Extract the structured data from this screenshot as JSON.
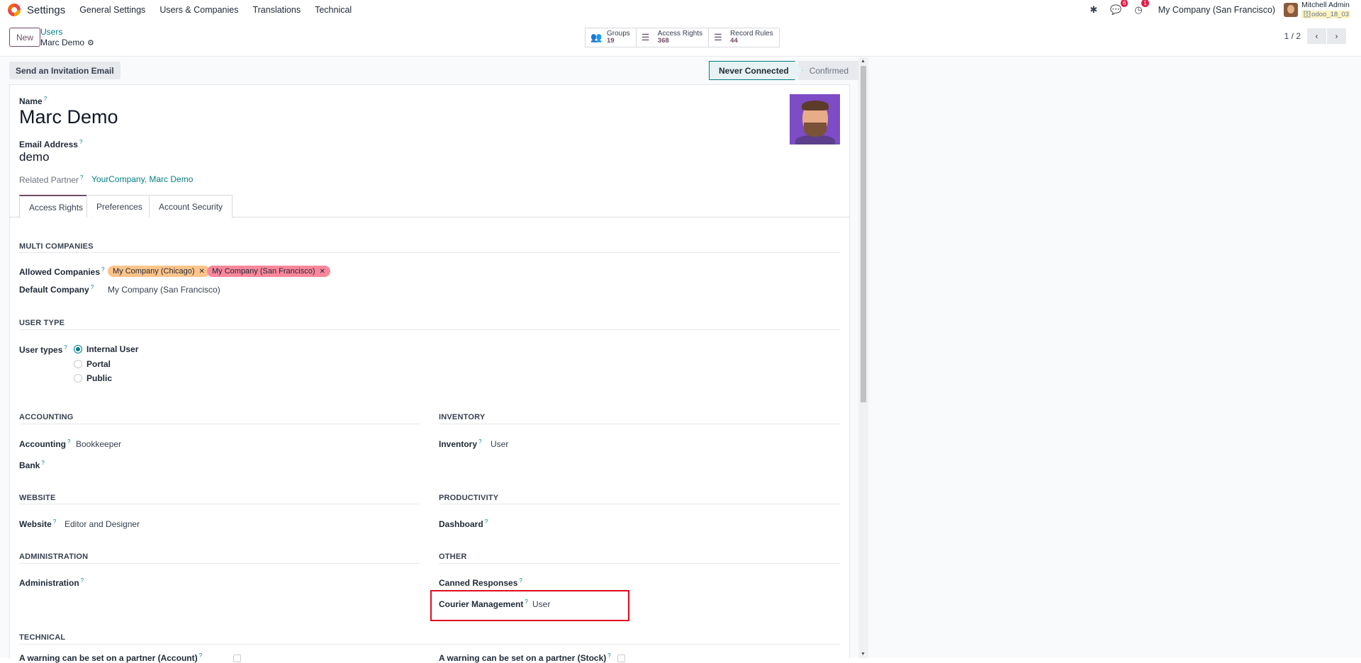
{
  "navbar": {
    "app_name": "Settings",
    "menu": [
      "General Settings",
      "Users & Companies",
      "Translations",
      "Technical"
    ],
    "messages_badge": "6",
    "activity_badge": "1",
    "company": "My Company (San Francisco)",
    "user_name": "Mitchell Admin",
    "db_name": "odoo_18_03"
  },
  "control": {
    "new_label": "New",
    "breadcrumb_parent": "Users",
    "breadcrumb_current": "Marc Demo",
    "smart_buttons": [
      {
        "label": "Groups",
        "count": "19"
      },
      {
        "label": "Access Rights",
        "count": "368"
      },
      {
        "label": "Record Rules",
        "count": "44"
      }
    ],
    "pager": "1 / 2"
  },
  "status": {
    "invite_label": "Send an Invitation Email",
    "steps": [
      "Never Connected",
      "Confirmed"
    ]
  },
  "form": {
    "name_label": "Name",
    "name_value": "Marc Demo",
    "email_label": "Email Address",
    "email_value": "demo",
    "partner_label": "Related Partner",
    "partner_value": "YourCompany, Marc Demo",
    "tabs": [
      "Access Rights",
      "Preferences",
      "Account Security"
    ]
  },
  "access": {
    "multi_companies": {
      "title": "MULTI COMPANIES",
      "allowed_label": "Allowed Companies",
      "allowed_tags": [
        "My Company (Chicago)",
        "My Company (San Francisco)"
      ],
      "default_label": "Default Company",
      "default_value": "My Company (San Francisco)"
    },
    "user_type": {
      "title": "USER TYPE",
      "label": "User types",
      "options": [
        "Internal User",
        "Portal",
        "Public"
      ],
      "selected": "Internal User"
    },
    "accounting": {
      "title": "ACCOUNTING",
      "accounting_label": "Accounting",
      "accounting_value": "Bookkeeper",
      "bank_label": "Bank"
    },
    "inventory": {
      "title": "INVENTORY",
      "label": "Inventory",
      "value": "User"
    },
    "website": {
      "title": "WEBSITE",
      "label": "Website",
      "value": "Editor and Designer"
    },
    "productivity": {
      "title": "PRODUCTIVITY",
      "label": "Dashboard"
    },
    "administration": {
      "title": "ADMINISTRATION",
      "label": "Administration"
    },
    "other": {
      "title": "OTHER",
      "canned_label": "Canned Responses",
      "courier_label": "Courier Management",
      "courier_value": "User"
    },
    "technical": {
      "title": "TECHNICAL",
      "warn_account": "A warning can be set on a partner (Account)",
      "warn_stock": "A warning can be set on a partner (Stock)"
    }
  },
  "colors": {
    "brand": "#714b67",
    "accent": "#017e84",
    "highlight": "#e00d1c",
    "tag1": "#ffc48a",
    "tag2": "#f9879b"
  }
}
